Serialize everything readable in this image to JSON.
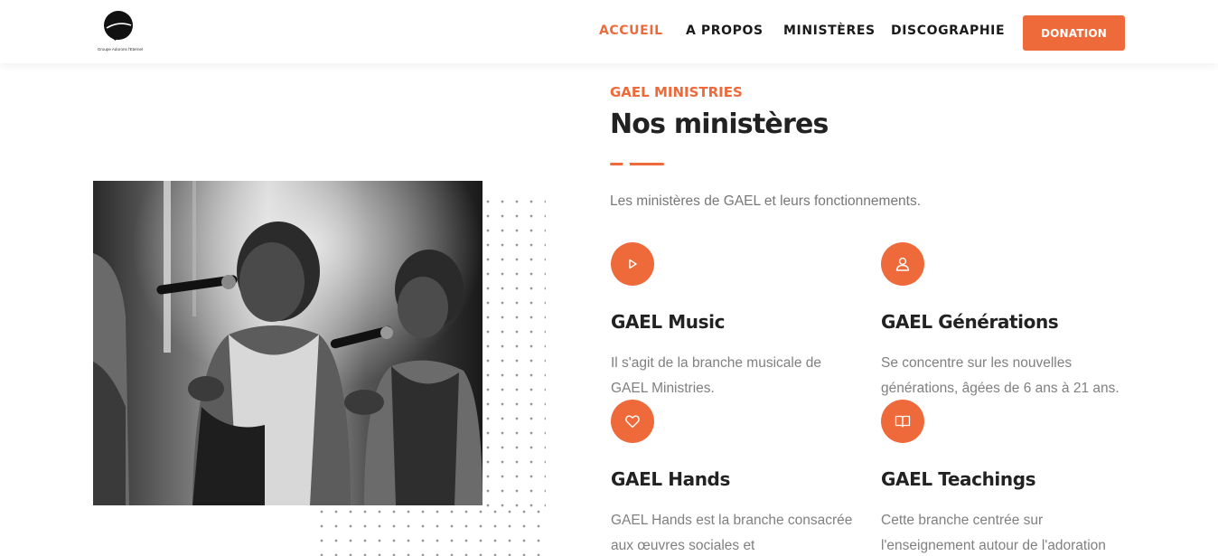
{
  "logo": {
    "text": "Groupe Adorons l'Eternel",
    "icon": "logo-icon"
  },
  "nav": {
    "items": [
      {
        "label": "ACCUEIL",
        "active": true
      },
      {
        "label": "A PROPOS",
        "active": false
      },
      {
        "label": "MINISTÈRES",
        "active": false
      },
      {
        "label": "DISCOGRAPHIE",
        "active": false
      }
    ],
    "donate_label": "DONATION"
  },
  "section": {
    "eyebrow": "GAEL MINISTRIES",
    "title": "Nos ministères",
    "lead": "Les ministères de GAEL et leurs fonctionnements."
  },
  "cards": [
    {
      "icon": "play-icon",
      "title": "GAEL Music",
      "text": "Il s'agit de la branche musicale de GAEL Ministries."
    },
    {
      "icon": "user-icon",
      "title": "GAEL Générations",
      "text": "Se concentre sur les nouvelles générations, âgées de 6 ans à 21 ans."
    },
    {
      "icon": "heart-icon",
      "title": "GAEL Hands",
      "text": "GAEL Hands est la branche consacrée aux œuvres sociales et"
    },
    {
      "icon": "book-icon",
      "title": "GAEL Teachings",
      "text": "Cette branche centrée sur l'enseignement autour de l'adoration"
    }
  ],
  "colors": {
    "accent": "#ef6a3a",
    "heading": "#222222",
    "body_text": "#808080"
  }
}
